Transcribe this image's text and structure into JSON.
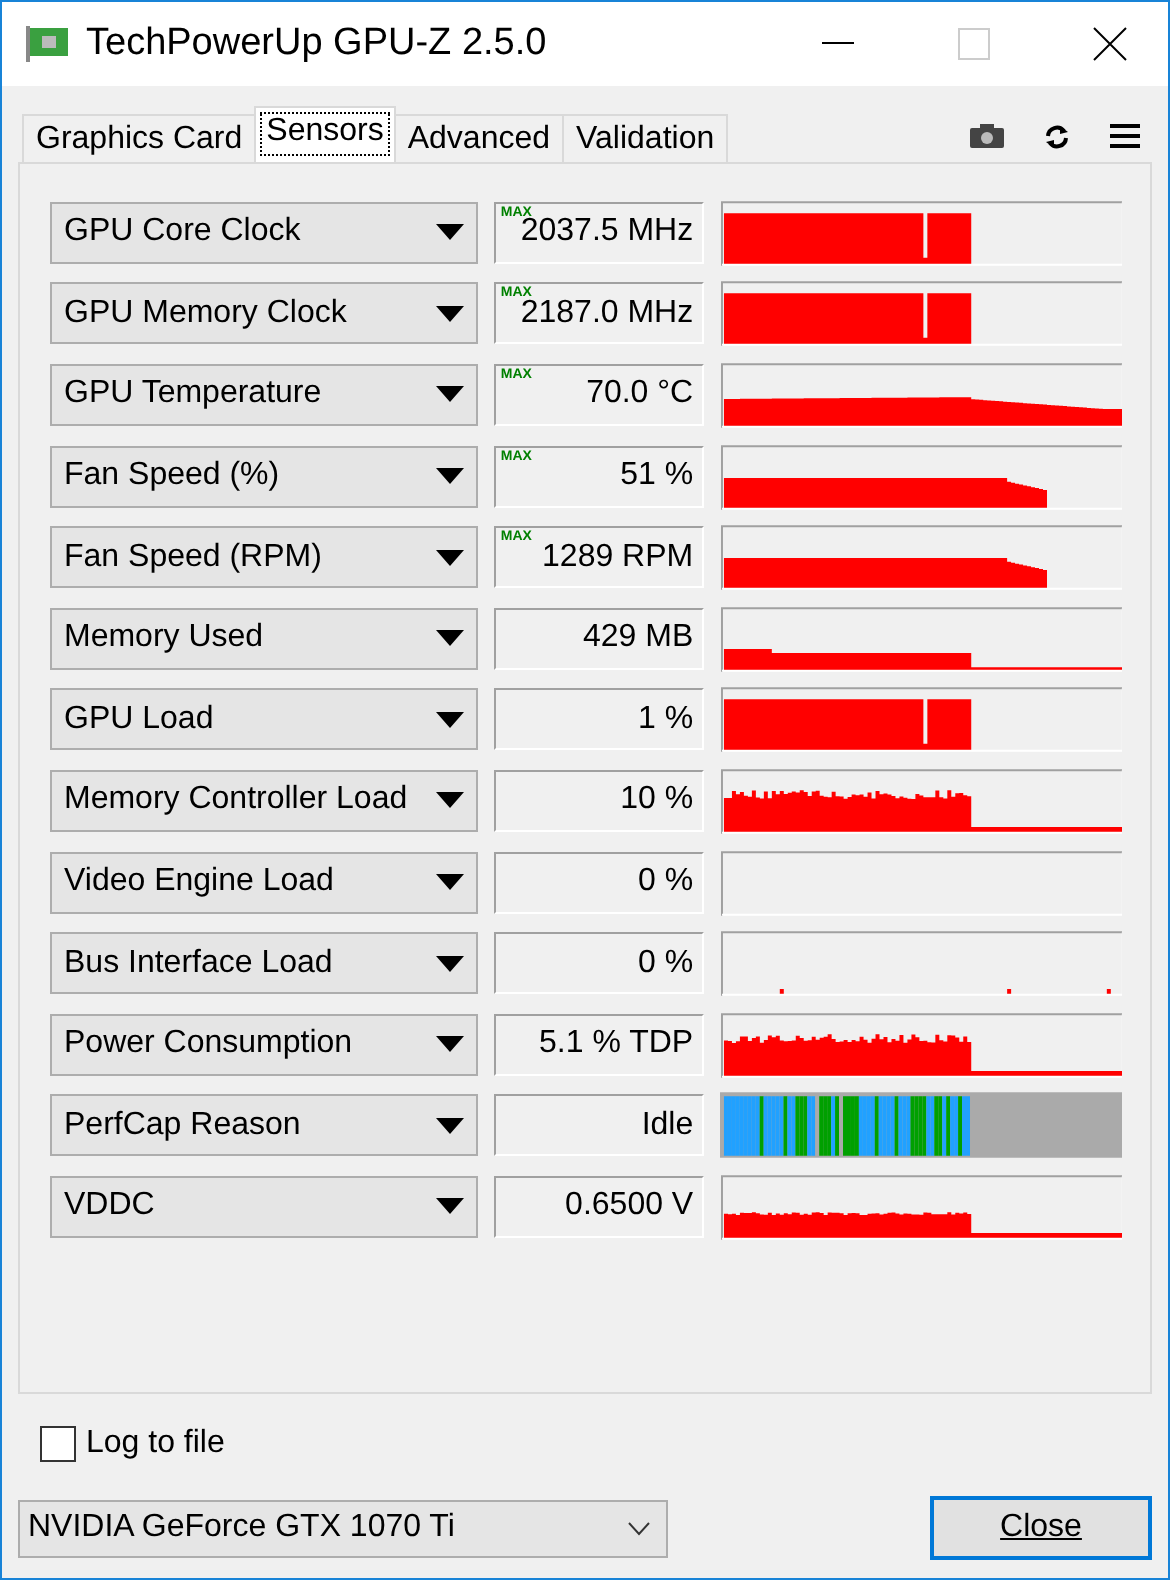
{
  "window": {
    "title": "TechPowerUp GPU-Z 2.5.0"
  },
  "tabs": [
    {
      "label": "Graphics Card",
      "selected": false
    },
    {
      "label": "Sensors",
      "selected": true
    },
    {
      "label": "Advanced",
      "selected": false
    },
    {
      "label": "Validation",
      "selected": false
    }
  ],
  "sensors": [
    {
      "name": "GPU Core Clock",
      "badge": "MAX",
      "value": "2037.5 MHz",
      "kind": "load"
    },
    {
      "name": "GPU Memory Clock",
      "badge": "MAX",
      "value": "2187.0 MHz",
      "kind": "load"
    },
    {
      "name": "GPU Temperature",
      "badge": "MAX",
      "value": "70.0 °C",
      "kind": "temp"
    },
    {
      "name": "Fan Speed (%)",
      "badge": "MAX",
      "value": "51 %",
      "kind": "fan"
    },
    {
      "name": "Fan Speed (RPM)",
      "badge": "MAX",
      "value": "1289 RPM",
      "kind": "fan"
    },
    {
      "name": "Memory Used",
      "value": "429 MB",
      "kind": "low"
    },
    {
      "name": "GPU Load",
      "value": "1 %",
      "kind": "load"
    },
    {
      "name": "Memory Controller Load",
      "value": "10 %",
      "kind": "noisy"
    },
    {
      "name": "Video Engine Load",
      "value": "0 %",
      "kind": "empty"
    },
    {
      "name": "Bus Interface Load",
      "value": "0 %",
      "kind": "spikes"
    },
    {
      "name": "Power Consumption",
      "value": "5.1 % TDP",
      "kind": "noisy"
    },
    {
      "name": "PerfCap Reason",
      "value": "Idle",
      "kind": "perfcap"
    },
    {
      "name": "VDDC",
      "value": "0.6500 V",
      "kind": "volt"
    }
  ],
  "log_to_file": {
    "label": "Log to file",
    "checked": false
  },
  "gpu_select": {
    "value": "NVIDIA GeForce GTX 1070 Ti"
  },
  "close_button": {
    "label": "Close"
  }
}
